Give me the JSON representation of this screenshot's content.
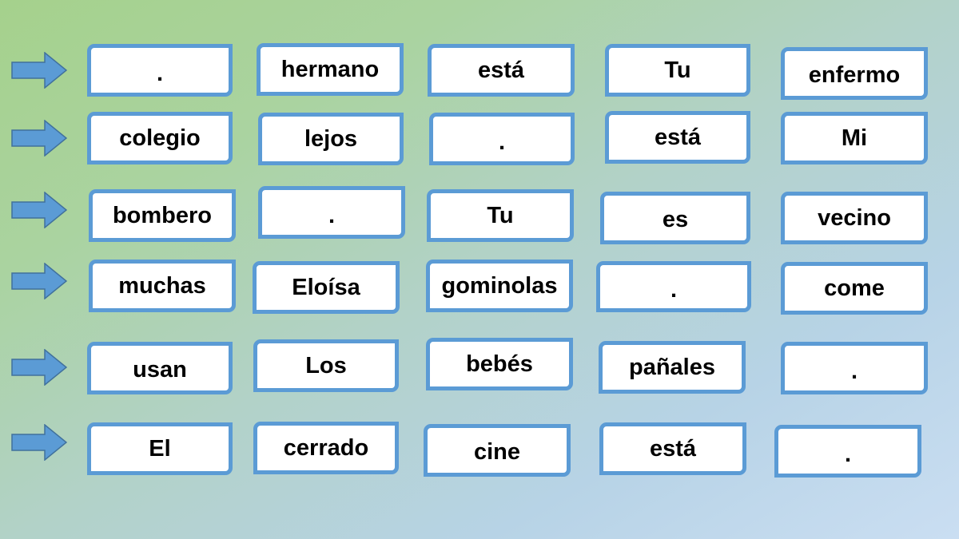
{
  "exercise": {
    "type": "sentence-ordering",
    "accent_color": "#5b9bd5",
    "arrow_icon": "right-arrow-icon",
    "rows": [
      {
        "words": [
          ".",
          "hermano",
          "está",
          "Tu",
          "enfermo"
        ]
      },
      {
        "words": [
          "colegio",
          "lejos",
          ".",
          "está",
          "Mi"
        ]
      },
      {
        "words": [
          "bombero",
          ".",
          "Tu",
          "es",
          "vecino"
        ]
      },
      {
        "words": [
          "muchas",
          "Eloísa",
          "gominolas",
          ".",
          "come"
        ]
      },
      {
        "words": [
          "usan",
          "Los",
          "bebés",
          "pañales",
          "."
        ]
      },
      {
        "words": [
          "El",
          "cerrado",
          "cine",
          "está",
          "."
        ]
      }
    ]
  }
}
